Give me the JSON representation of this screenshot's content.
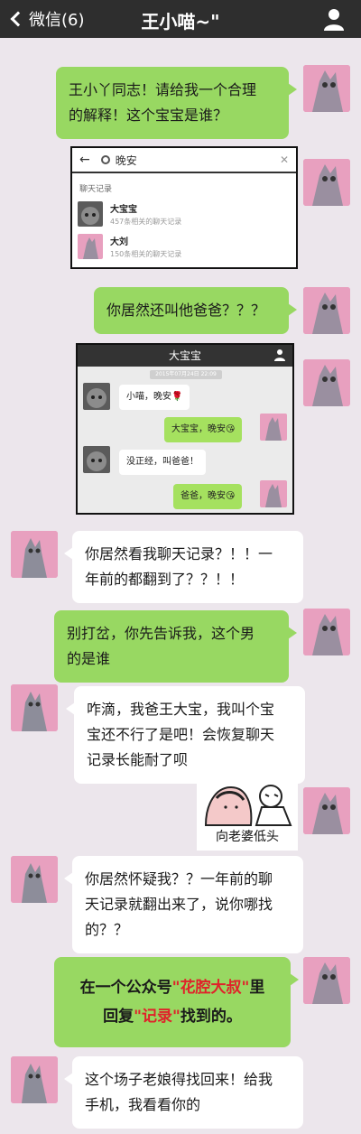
{
  "header": {
    "back_label": "微信(6)",
    "title": "王小喵~\""
  },
  "messages": {
    "m1": {
      "line1": "王小丫同志！请给我一个合理",
      "line2": "的解释！这个宝宝是谁？"
    },
    "m3": {
      "text": "你居然还叫他爸爸？？？"
    },
    "m5": {
      "line1": "你居然看我聊天记录？！！一",
      "line2": "年前的都翻到了？？！！"
    },
    "m6": {
      "line1": "别打岔，你先告诉我，这个男",
      "line2": "的是谁"
    },
    "m7": {
      "line1": "咋滴，我爸王大宝，我叫个宝",
      "line2": "宝还不行了是吧！会恢复聊天",
      "line3": "记录长能耐了呗"
    },
    "m9": {
      "line1": "你居然怀疑我？？一年前的聊",
      "line2": "天记录就翻出来了，说你哪找",
      "line3": "的？？"
    },
    "m10": {
      "a": "在一个公众号",
      "b": "\"花腔大叔\"",
      "c": "里",
      "d": "回复",
      "e": "\"记录\"",
      "f": "找到的。"
    },
    "m11": {
      "line1": "这个场子老娘得找回来！给我",
      "line2": "手机，我看看你的"
    }
  },
  "search_shot": {
    "query": "晚安",
    "section": "聊天记录",
    "results": [
      {
        "name": "大宝宝",
        "sub": "457条相关的聊天记录"
      },
      {
        "name": "大刘",
        "sub": "150条相关的聊天记录"
      }
    ]
  },
  "chat_shot": {
    "title": "大宝宝",
    "time": "2015年07月24日 22:09",
    "msgs": [
      "小喵，晚安🌹",
      "大宝宝，晚安😘",
      "没正经，叫爸爸！",
      "爸爸，晚安😘"
    ]
  },
  "sticker": {
    "caption": "向老婆低头"
  }
}
